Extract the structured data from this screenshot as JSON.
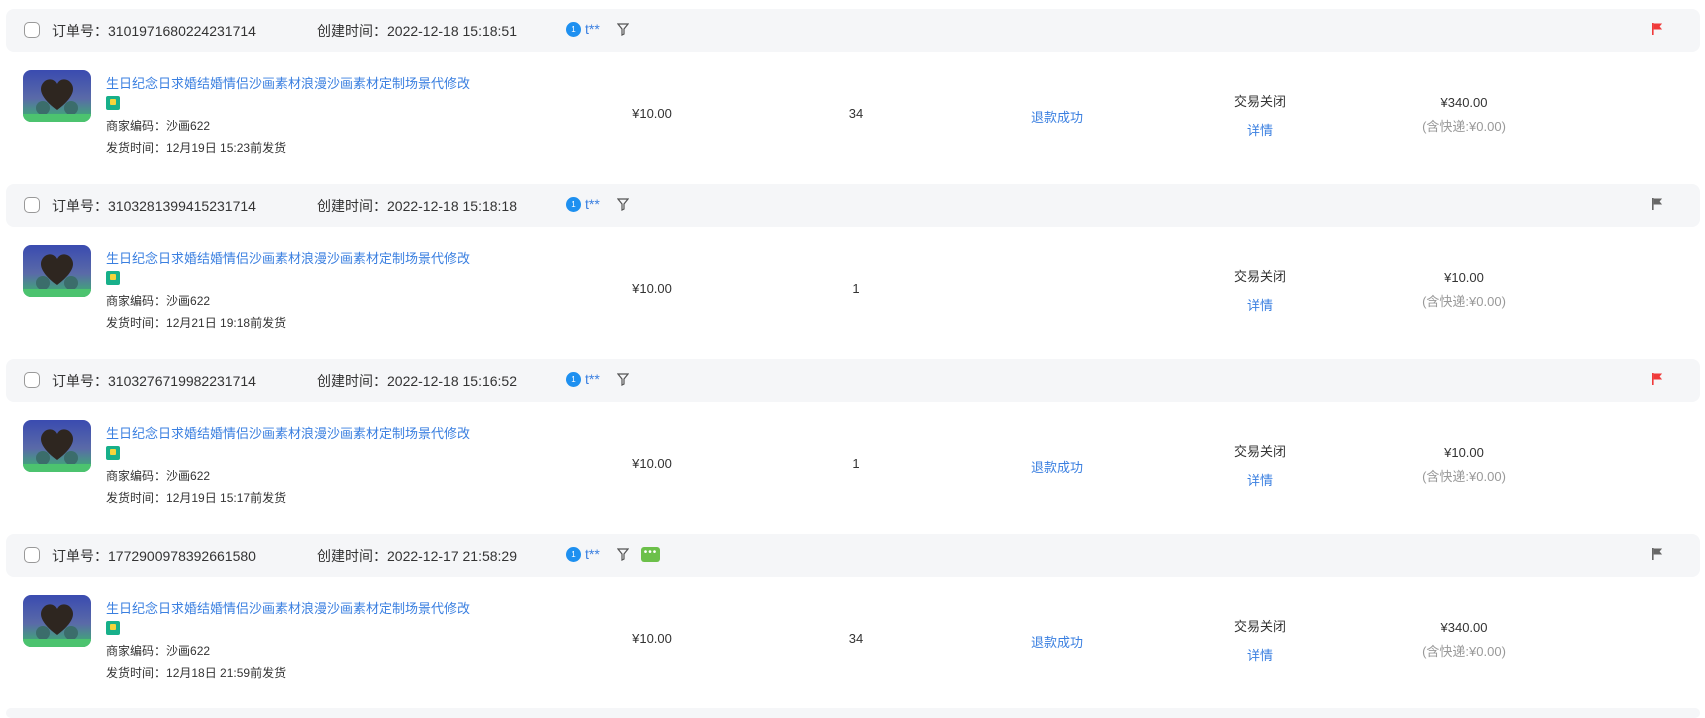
{
  "labels": {
    "order_no": "订单号：",
    "created": "创建时间：",
    "merchant_code": "商家编码：",
    "ship_time": "发货时间：",
    "detail": "详情"
  },
  "colors": {
    "flag_red": "#f03a3a",
    "flag_grey": "#666666",
    "link": "#3a7fe0"
  },
  "orders": [
    {
      "order_no": "3101971680224231714",
      "created": "2022-12-18 15:18:51",
      "buyer": "t**",
      "flag": "red",
      "chat": false,
      "title": "生日纪念日求婚结婚情侣沙画素材浪漫沙画素材定制场景代修改",
      "merchant_code": "沙画622",
      "ship_time": "12月19日 15:23前发货",
      "price": "¥10.00",
      "qty": "34",
      "refund": "退款成功",
      "status": "交易关闭",
      "total": "¥340.00",
      "shipping": "(含快递:¥0.00)"
    },
    {
      "order_no": "3103281399415231714",
      "created": "2022-12-18 15:18:18",
      "buyer": "t**",
      "flag": "grey",
      "chat": false,
      "title": "生日纪念日求婚结婚情侣沙画素材浪漫沙画素材定制场景代修改",
      "merchant_code": "沙画622",
      "ship_time": "12月21日 19:18前发货",
      "price": "¥10.00",
      "qty": "1",
      "refund": "",
      "status": "交易关闭",
      "total": "¥10.00",
      "shipping": "(含快递:¥0.00)"
    },
    {
      "order_no": "3103276719982231714",
      "created": "2022-12-18 15:16:52",
      "buyer": "t**",
      "flag": "red",
      "chat": false,
      "title": "生日纪念日求婚结婚情侣沙画素材浪漫沙画素材定制场景代修改",
      "merchant_code": "沙画622",
      "ship_time": "12月19日 15:17前发货",
      "price": "¥10.00",
      "qty": "1",
      "refund": "退款成功",
      "status": "交易关闭",
      "total": "¥10.00",
      "shipping": "(含快递:¥0.00)"
    },
    {
      "order_no": "1772900978392661580",
      "created": "2022-12-17 21:58:29",
      "buyer": "t**",
      "flag": "grey",
      "chat": true,
      "title": "生日纪念日求婚结婚情侣沙画素材浪漫沙画素材定制场景代修改",
      "merchant_code": "沙画622",
      "ship_time": "12月18日 21:59前发货",
      "price": "¥10.00",
      "qty": "34",
      "refund": "退款成功",
      "status": "交易关闭",
      "total": "¥340.00",
      "shipping": "(含快递:¥0.00)"
    }
  ]
}
